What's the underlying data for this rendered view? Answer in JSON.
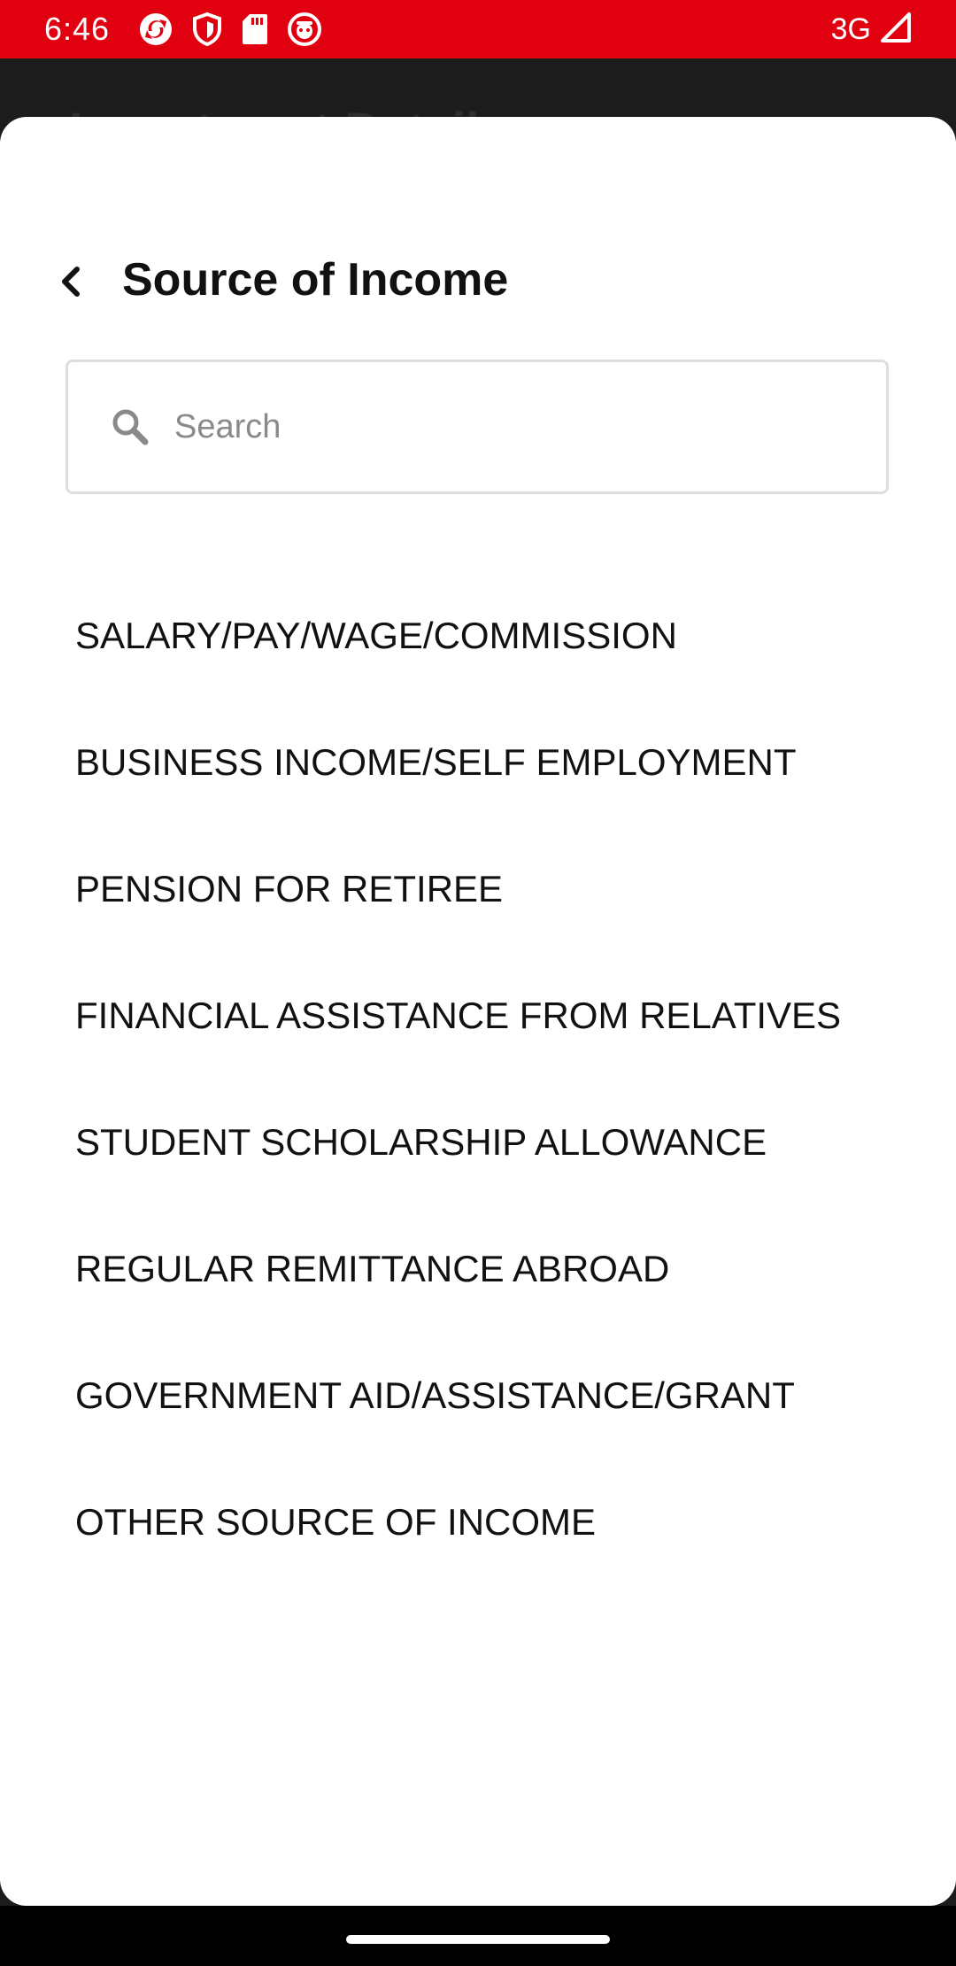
{
  "status_bar": {
    "time": "6:46",
    "network": "3G",
    "icons": [
      "refresh-app-icon",
      "shield-icon",
      "sd-card-icon",
      "notification-app-icon",
      "signal-icon"
    ]
  },
  "background": {
    "title": "Investment Details"
  },
  "sheet": {
    "title": "Source of Income",
    "back_icon": "chevron-left-icon",
    "search": {
      "placeholder": "Search",
      "value": ""
    },
    "options": [
      {
        "label": "SALARY/PAY/WAGE/COMMISSION"
      },
      {
        "label": "BUSINESS INCOME/SELF EMPLOYMENT"
      },
      {
        "label": "PENSION FOR RETIREE"
      },
      {
        "label": "FINANCIAL ASSISTANCE FROM RELATIVES"
      },
      {
        "label": "STUDENT SCHOLARSHIP ALLOWANCE"
      },
      {
        "label": "REGULAR REMITTANCE ABROAD"
      },
      {
        "label": "GOVERNMENT AID/ASSISTANCE/GRANT"
      },
      {
        "label": "OTHER SOURCE OF INCOME"
      }
    ]
  },
  "colors": {
    "status_bar": "#e0000f",
    "sheet_background": "#ffffff",
    "text": "#111111"
  }
}
